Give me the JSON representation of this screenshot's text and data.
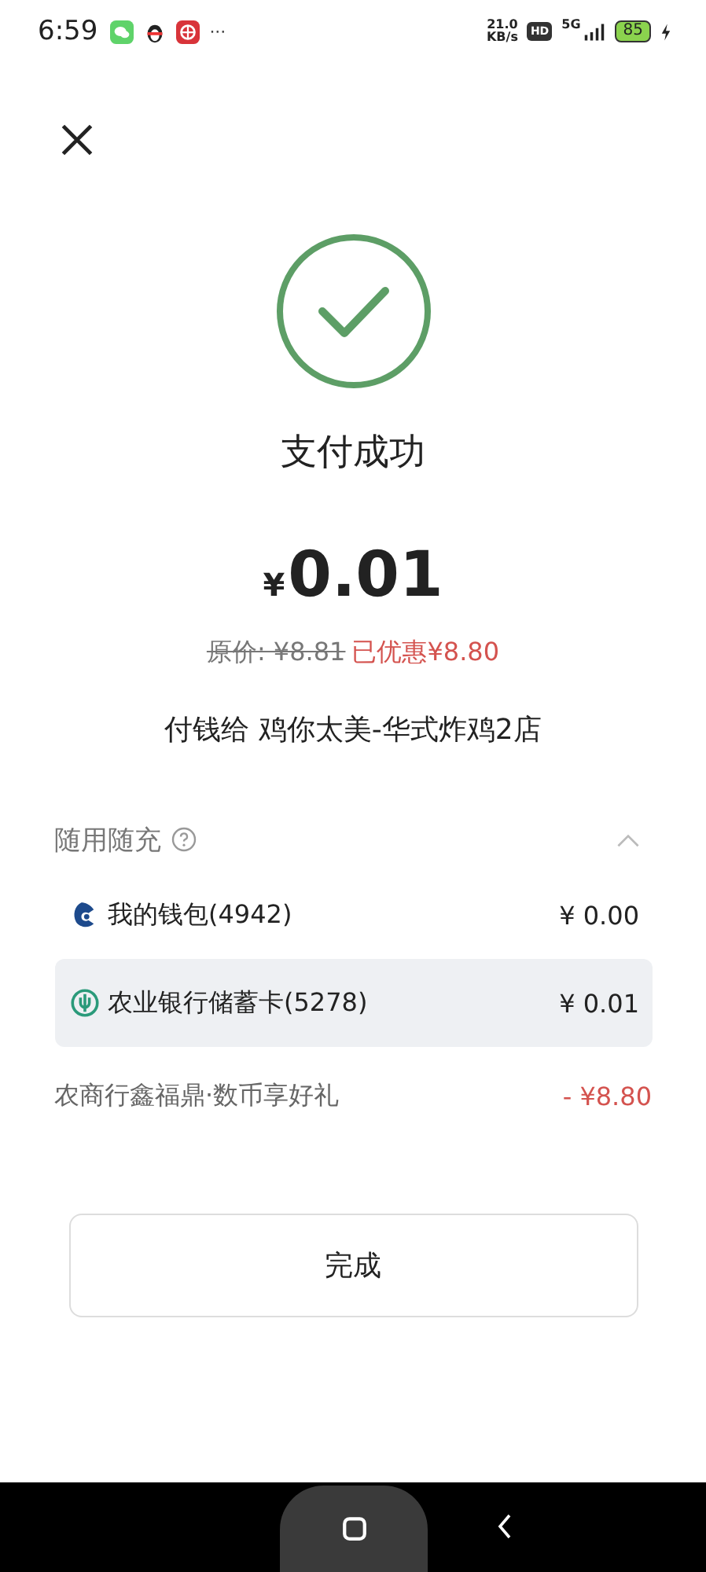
{
  "status_bar": {
    "time": "6:59",
    "more": "···",
    "net_speed": "21.0",
    "net_unit": "KB/s",
    "hd": "HD",
    "network": "5G",
    "battery": "85"
  },
  "result": {
    "title": "支付成功",
    "currency": "¥",
    "amount": "0.01",
    "original_price": "原价: ¥8.81",
    "discount": "已优惠¥8.80",
    "payee": "付钱给 鸡你太美-华式炸鸡2店"
  },
  "payment": {
    "title": "随用随充",
    "expanded": true,
    "methods": [
      {
        "kind": "wallet",
        "name": "我的钱包(4942)",
        "amount": "¥ 0.00",
        "selected": false
      },
      {
        "kind": "bank",
        "name": "农业银行储蓄卡(5278)",
        "amount": "¥ 0.01",
        "selected": true
      }
    ],
    "promotion": {
      "name": "农商行鑫福鼎·数币享好礼",
      "amount": "- ¥8.80"
    }
  },
  "done_button": "完成"
}
